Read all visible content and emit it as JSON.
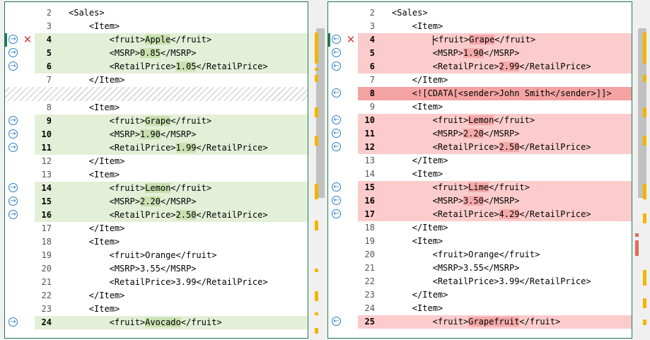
{
  "left": {
    "rows": [
      {
        "ln": "2",
        "indent": 0,
        "parts": [
          {
            "t": "<Sales>"
          }
        ],
        "bg": ""
      },
      {
        "ln": "3",
        "indent": 1,
        "parts": [
          {
            "t": "<Item>"
          }
        ],
        "bg": ""
      },
      {
        "ln": "4",
        "indent": 2,
        "parts": [
          {
            "t": "<fruit>"
          },
          {
            "t": "Apple",
            "h": 1
          },
          {
            "t": "</fruit>"
          }
        ],
        "bg": "green",
        "arrow": 1,
        "xmark": 1,
        "sel": 1
      },
      {
        "ln": "5",
        "indent": 2,
        "parts": [
          {
            "t": "<MSRP>"
          },
          {
            "t": "0.85",
            "h": 1
          },
          {
            "t": "</MSRP>"
          }
        ],
        "bg": "green",
        "arrow": 1
      },
      {
        "ln": "6",
        "indent": 2,
        "parts": [
          {
            "t": "<RetailPrice>"
          },
          {
            "t": "1.05",
            "h": 1
          },
          {
            "t": "</RetailPrice>"
          }
        ],
        "bg": "green",
        "arrow": 1
      },
      {
        "ln": "7",
        "indent": 1,
        "parts": [
          {
            "t": "</Item>"
          }
        ],
        "bg": ""
      },
      {
        "ln": "",
        "gap": 1
      },
      {
        "ln": "8",
        "indent": 1,
        "parts": [
          {
            "t": "<Item>"
          }
        ],
        "bg": ""
      },
      {
        "ln": "9",
        "indent": 2,
        "parts": [
          {
            "t": "<fruit>"
          },
          {
            "t": "Grape",
            "h": 1
          },
          {
            "t": "</fruit>"
          }
        ],
        "bg": "green",
        "arrow": 1
      },
      {
        "ln": "10",
        "indent": 2,
        "parts": [
          {
            "t": "<MSRP>"
          },
          {
            "t": "1.90",
            "h": 1
          },
          {
            "t": "</MSRP>"
          }
        ],
        "bg": "green",
        "arrow": 1
      },
      {
        "ln": "11",
        "indent": 2,
        "parts": [
          {
            "t": "<RetailPrice>"
          },
          {
            "t": "1.99",
            "h": 1
          },
          {
            "t": "</RetailPrice>"
          }
        ],
        "bg": "green",
        "arrow": 1
      },
      {
        "ln": "12",
        "indent": 1,
        "parts": [
          {
            "t": "</Item>"
          }
        ],
        "bg": ""
      },
      {
        "ln": "13",
        "indent": 1,
        "parts": [
          {
            "t": "<Item>"
          }
        ],
        "bg": ""
      },
      {
        "ln": "14",
        "indent": 2,
        "parts": [
          {
            "t": "<fruit>"
          },
          {
            "t": "Lemon",
            "h": 1
          },
          {
            "t": "</fruit>"
          }
        ],
        "bg": "green",
        "arrow": 1
      },
      {
        "ln": "15",
        "indent": 2,
        "parts": [
          {
            "t": "<MSRP>"
          },
          {
            "t": "2.20",
            "h": 1
          },
          {
            "t": "</MSRP>"
          }
        ],
        "bg": "green",
        "arrow": 1
      },
      {
        "ln": "16",
        "indent": 2,
        "parts": [
          {
            "t": "<RetailPrice>"
          },
          {
            "t": "2.50",
            "h": 1
          },
          {
            "t": "</RetailPrice>"
          }
        ],
        "bg": "green",
        "arrow": 1
      },
      {
        "ln": "17",
        "indent": 1,
        "parts": [
          {
            "t": "</Item>"
          }
        ],
        "bg": ""
      },
      {
        "ln": "18",
        "indent": 1,
        "parts": [
          {
            "t": "<Item>"
          }
        ],
        "bg": ""
      },
      {
        "ln": "19",
        "indent": 2,
        "parts": [
          {
            "t": "<fruit>Orange</fruit>"
          }
        ],
        "bg": ""
      },
      {
        "ln": "20",
        "indent": 2,
        "parts": [
          {
            "t": "<MSRP>3.55</MSRP>"
          }
        ],
        "bg": ""
      },
      {
        "ln": "21",
        "indent": 2,
        "parts": [
          {
            "t": "<RetailPrice>3.99</RetailPrice>"
          }
        ],
        "bg": ""
      },
      {
        "ln": "22",
        "indent": 1,
        "parts": [
          {
            "t": "</Item>"
          }
        ],
        "bg": ""
      },
      {
        "ln": "23",
        "indent": 1,
        "parts": [
          {
            "t": "<Item>"
          }
        ],
        "bg": ""
      },
      {
        "ln": "24",
        "indent": 2,
        "parts": [
          {
            "t": "<fruit>"
          },
          {
            "t": "Avocado",
            "h": 1
          },
          {
            "t": "</fruit>"
          }
        ],
        "bg": "green",
        "arrow": 1
      }
    ]
  },
  "right": {
    "rows": [
      {
        "ln": "2",
        "indent": 0,
        "parts": [
          {
            "t": "<Sales>"
          }
        ],
        "bg": ""
      },
      {
        "ln": "3",
        "indent": 1,
        "parts": [
          {
            "t": "<Item>"
          }
        ],
        "bg": ""
      },
      {
        "ln": "4",
        "indent": 2,
        "parts": [
          {
            "t": "<fruit>"
          },
          {
            "t": "Grape",
            "h": 1
          },
          {
            "t": "</fruit>"
          }
        ],
        "bg": "red",
        "arrow": 1,
        "xmark": 1,
        "sel": 1,
        "caret": 1
      },
      {
        "ln": "5",
        "indent": 2,
        "parts": [
          {
            "t": "<MSRP>"
          },
          {
            "t": "1.90",
            "h": 1
          },
          {
            "t": "</MSRP>"
          }
        ],
        "bg": "red",
        "arrow": 1
      },
      {
        "ln": "6",
        "indent": 2,
        "parts": [
          {
            "t": "<RetailPrice>"
          },
          {
            "t": "2.99",
            "h": 1
          },
          {
            "t": "</RetailPrice>"
          }
        ],
        "bg": "red",
        "arrow": 1
      },
      {
        "ln": "7",
        "indent": 1,
        "parts": [
          {
            "t": "</Item>"
          }
        ],
        "bg": ""
      },
      {
        "ln": "8",
        "indent": 1,
        "parts": [
          {
            "t": "<![CDATA[<sender>John Smith</sender>]]>"
          }
        ],
        "bg": "red-strong",
        "arrow": 1
      },
      {
        "ln": "9",
        "indent": 1,
        "parts": [
          {
            "t": "<Item>"
          }
        ],
        "bg": ""
      },
      {
        "ln": "10",
        "indent": 2,
        "parts": [
          {
            "t": "<fruit>"
          },
          {
            "t": "Lemon",
            "h": 1
          },
          {
            "t": "</fruit>"
          }
        ],
        "bg": "red",
        "arrow": 1
      },
      {
        "ln": "11",
        "indent": 2,
        "parts": [
          {
            "t": "<MSRP>"
          },
          {
            "t": "2.20",
            "h": 1
          },
          {
            "t": "</MSRP>"
          }
        ],
        "bg": "red",
        "arrow": 1
      },
      {
        "ln": "12",
        "indent": 2,
        "parts": [
          {
            "t": "<RetailPrice>"
          },
          {
            "t": "2.50",
            "h": 1
          },
          {
            "t": "</RetailPrice>"
          }
        ],
        "bg": "red",
        "arrow": 1
      },
      {
        "ln": "13",
        "indent": 1,
        "parts": [
          {
            "t": "</Item>"
          }
        ],
        "bg": ""
      },
      {
        "ln": "14",
        "indent": 1,
        "parts": [
          {
            "t": "<Item>"
          }
        ],
        "bg": ""
      },
      {
        "ln": "15",
        "indent": 2,
        "parts": [
          {
            "t": "<fruit>"
          },
          {
            "t": "Lime",
            "h": 1
          },
          {
            "t": "</fruit>"
          }
        ],
        "bg": "red",
        "arrow": 1
      },
      {
        "ln": "16",
        "indent": 2,
        "parts": [
          {
            "t": "<MSRP>"
          },
          {
            "t": "3.50",
            "h": 1
          },
          {
            "t": "</MSRP>"
          }
        ],
        "bg": "red",
        "arrow": 1
      },
      {
        "ln": "17",
        "indent": 2,
        "parts": [
          {
            "t": "<RetailPrice>"
          },
          {
            "t": "4.29",
            "h": 1
          },
          {
            "t": "</RetailPrice>"
          }
        ],
        "bg": "red",
        "arrow": 1
      },
      {
        "ln": "18",
        "indent": 1,
        "parts": [
          {
            "t": "</Item>"
          }
        ],
        "bg": ""
      },
      {
        "ln": "19",
        "indent": 1,
        "parts": [
          {
            "t": "<Item>"
          }
        ],
        "bg": ""
      },
      {
        "ln": "20",
        "indent": 2,
        "parts": [
          {
            "t": "<fruit>Orange</fruit>"
          }
        ],
        "bg": ""
      },
      {
        "ln": "21",
        "indent": 2,
        "parts": [
          {
            "t": "<MSRP>3.55</MSRP>"
          }
        ],
        "bg": ""
      },
      {
        "ln": "22",
        "indent": 2,
        "parts": [
          {
            "t": "<RetailPrice>3.99</RetailPrice>"
          }
        ],
        "bg": ""
      },
      {
        "ln": "23",
        "indent": 1,
        "parts": [
          {
            "t": "</Item>"
          }
        ],
        "bg": ""
      },
      {
        "ln": "24",
        "indent": 1,
        "parts": [
          {
            "t": "<Item>"
          }
        ],
        "bg": ""
      },
      {
        "ln": "25",
        "indent": 2,
        "parts": [
          {
            "t": "<fruit>"
          },
          {
            "t": "Grapefruit",
            "h": 1
          },
          {
            "t": "</fruit>"
          }
        ],
        "bg": "red",
        "arrow": 1
      }
    ]
  },
  "icons": {
    "arrow_right": "arrow-right-circle-icon",
    "arrow_left": "arrow-left-circle-icon",
    "reject": "close-icon"
  },
  "glyphs": {
    "arrow_right": "→",
    "arrow_left": "←",
    "reject": "✕"
  },
  "colors": {
    "added": "#e3efd7",
    "removed": "#fccccc",
    "removed_strong": "#f4a3a3",
    "arrow": "#2b7cc8",
    "reject": "#d23a3a",
    "overview_marker": "#f1b500"
  }
}
